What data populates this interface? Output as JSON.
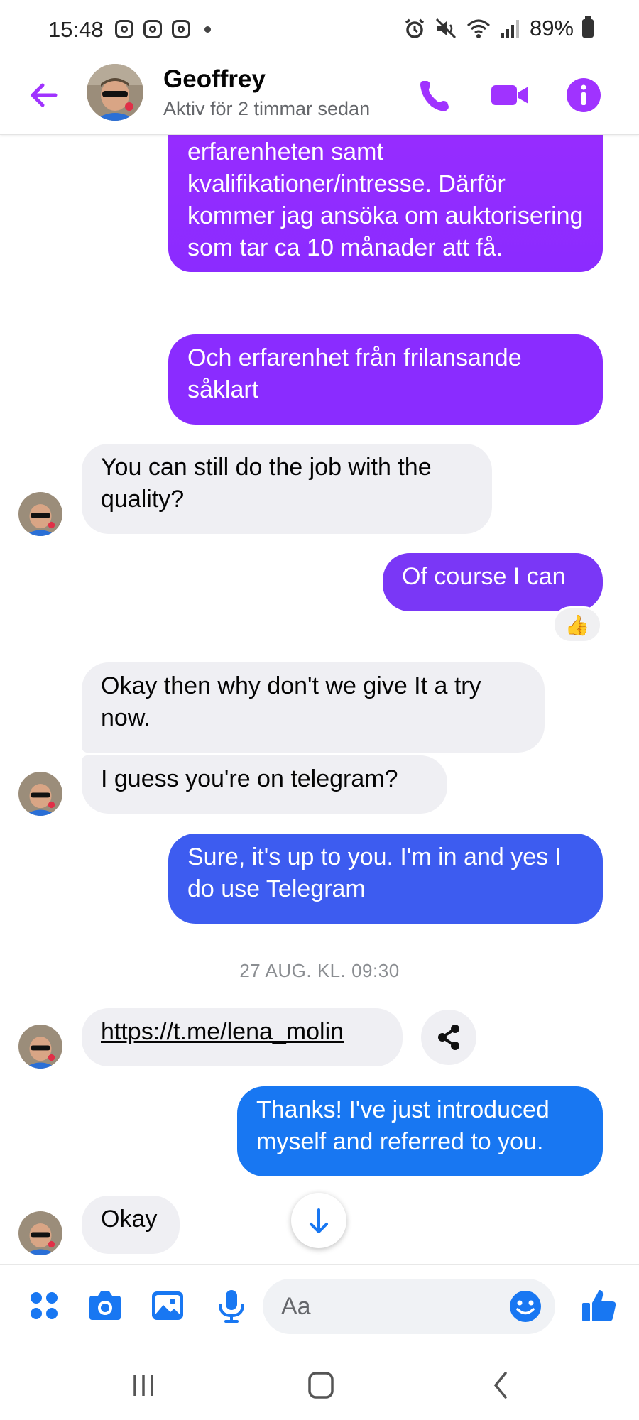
{
  "status_bar": {
    "time": "15:48",
    "battery": "89%"
  },
  "header": {
    "contact_name": "Geoffrey",
    "status": "Aktiv för 2 timmar sedan"
  },
  "messages": [
    {
      "direction": "out",
      "text": "erfarenheten samt kvalifikationer/intresse. Därför kommer jag ansöka om auktorisering som tar ca 10 månader att få."
    },
    {
      "direction": "out",
      "text": "Och erfarenhet från frilansande såklart"
    },
    {
      "direction": "in",
      "text": "You can still do the job with the quality?"
    },
    {
      "direction": "out",
      "text": "Of course I can",
      "reaction": "👍"
    },
    {
      "direction": "in",
      "text": "Okay then why don't we give It a try now."
    },
    {
      "direction": "in",
      "text": "I guess you're on telegram?"
    },
    {
      "direction": "out",
      "text": "Sure, it's up to you. I'm in and yes I do use Telegram"
    },
    {
      "direction": "in",
      "text": "https://t.me/lena_molin"
    },
    {
      "direction": "out",
      "text": "Thanks! I've just introduced myself and referred to you."
    },
    {
      "direction": "in",
      "text": "Okay"
    }
  ],
  "timestamp": "27 AUG. KL. 09:30",
  "composer": {
    "placeholder": "Aa"
  },
  "colors": {
    "accent": "#a033ff",
    "purple_bubble": "#8a2bff",
    "blue_bubble": "#3a5ff2",
    "light_blue_bubble": "#1d78f5",
    "incoming_bubble": "#efeff3"
  }
}
